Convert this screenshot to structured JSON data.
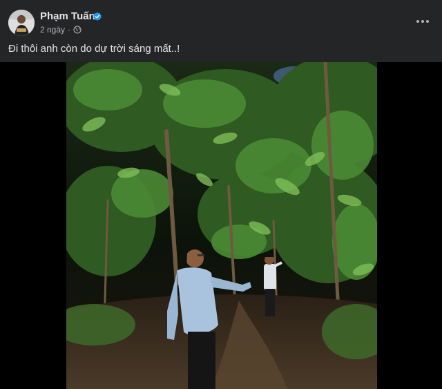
{
  "post": {
    "author_name": "Phạm Tuấn",
    "timestamp": "2 ngày",
    "separator": "·",
    "privacy_icon": "globe-icon",
    "verified_icon": "verified-badge-icon",
    "more_icon": "more-horizontal-icon",
    "text": "Đi thôi anh còn do dự trời sáng mất..!"
  },
  "media": {
    "type": "photo",
    "subject": "two men walking on a forest trail at dusk"
  },
  "colors": {
    "background": "#242526",
    "primary_text": "#e4e6eb",
    "secondary_text": "#b0b3b8",
    "verified_blue": "#1d9bf0",
    "media_background": "#000000"
  }
}
